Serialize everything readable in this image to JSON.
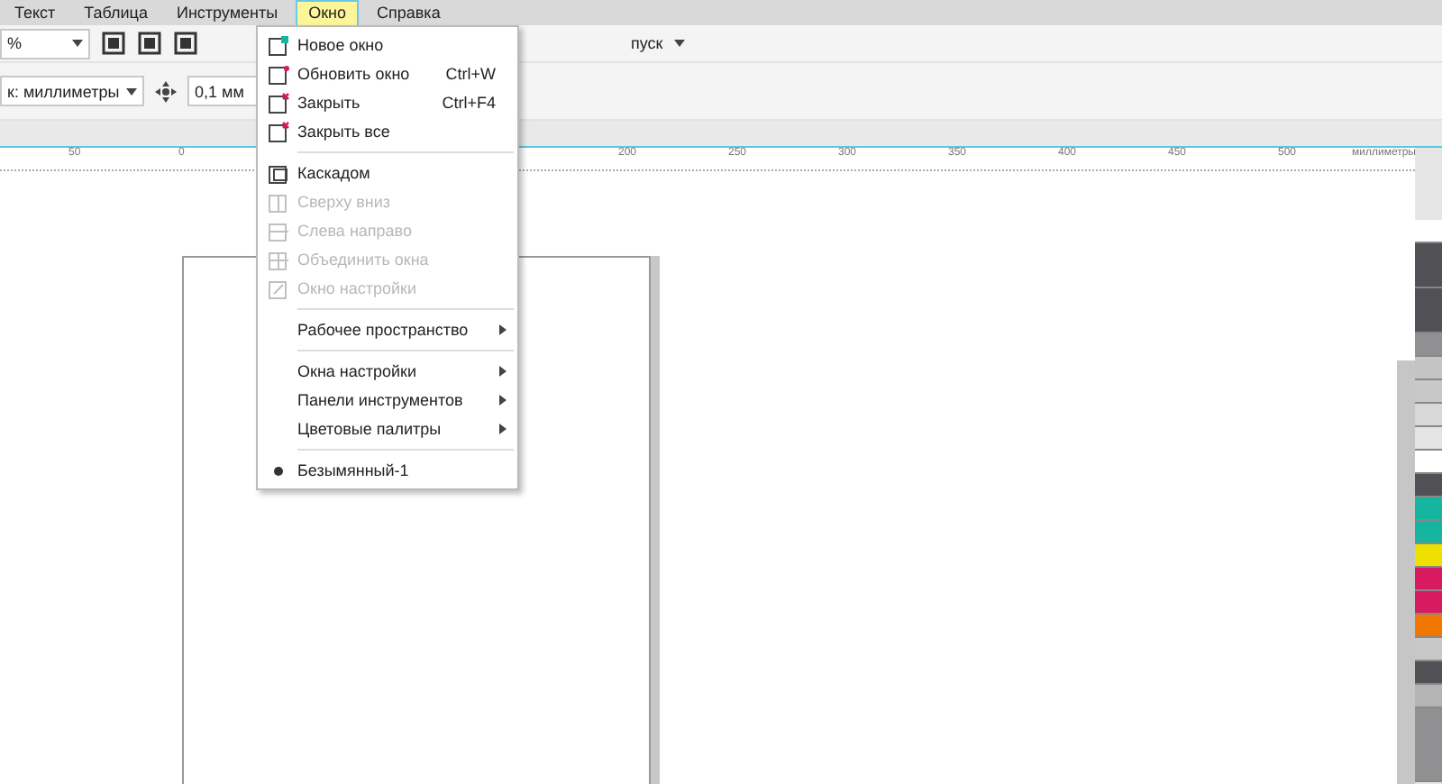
{
  "menu_bar": [
    {
      "label": "Текст",
      "selected": false
    },
    {
      "label": "Таблица",
      "selected": false
    },
    {
      "label": "Инструменты",
      "selected": false
    },
    {
      "label": "Окно",
      "selected": true
    },
    {
      "label": "Справка",
      "selected": false
    }
  ],
  "toolbar": {
    "zoom_value": "%",
    "launch_label": "пуск"
  },
  "property_bar": {
    "units": "к: миллиметры",
    "nudge": "0,1 мм"
  },
  "ruler": {
    "labels": [
      "50",
      "0",
      "200",
      "250",
      "300",
      "350",
      "400",
      "450",
      "500"
    ],
    "units": "миллиметры"
  },
  "window_menu": [
    {
      "kind": "item",
      "label": "Новое окно",
      "disabled": false
    },
    {
      "kind": "item",
      "label": "Обновить окно",
      "shortcut": "Ctrl+W",
      "disabled": false
    },
    {
      "kind": "item",
      "label": "Закрыть",
      "shortcut": "Ctrl+F4",
      "disabled": false
    },
    {
      "kind": "item",
      "label": "Закрыть все",
      "disabled": false
    },
    {
      "kind": "separator"
    },
    {
      "kind": "item",
      "label": "Каскадом",
      "disabled": false
    },
    {
      "kind": "item",
      "label": "Сверху вниз",
      "disabled": true
    },
    {
      "kind": "item",
      "label": "Слева направо",
      "disabled": true
    },
    {
      "kind": "item",
      "label": "Объединить окна",
      "disabled": true
    },
    {
      "kind": "item",
      "label": "Окно настройки",
      "disabled": true
    },
    {
      "kind": "separator"
    },
    {
      "kind": "submenu",
      "label": "Рабочее пространство"
    },
    {
      "kind": "separator"
    },
    {
      "kind": "submenu",
      "label": "Окна настройки"
    },
    {
      "kind": "submenu",
      "label": "Панели инструментов"
    },
    {
      "kind": "submenu",
      "label": "Цветовые палитры"
    },
    {
      "kind": "separator"
    },
    {
      "kind": "radio",
      "label": "Безымянный-1",
      "selected": true
    }
  ],
  "palette": [
    {
      "color": "#ffffff"
    },
    {
      "color": "#505055"
    },
    {
      "color": "#505055"
    },
    {
      "color": "#909092"
    },
    {
      "color": "#c4c4c4"
    },
    {
      "color": "#c8c8c8"
    },
    {
      "color": "#d8d8d8"
    },
    {
      "color": "#e4e4e4"
    },
    {
      "color": "#ffffff"
    },
    {
      "color": "#505055"
    },
    {
      "color": "#16b5a0"
    },
    {
      "color": "#16b5a0"
    },
    {
      "color": "#eee000"
    },
    {
      "color": "#d81b60"
    },
    {
      "color": "#d81b60"
    },
    {
      "color": "#f07800"
    },
    {
      "color": "#c8c8c8"
    },
    {
      "color": "#505055"
    },
    {
      "color": "#b4b4b4"
    },
    {
      "color": "#909092"
    }
  ]
}
